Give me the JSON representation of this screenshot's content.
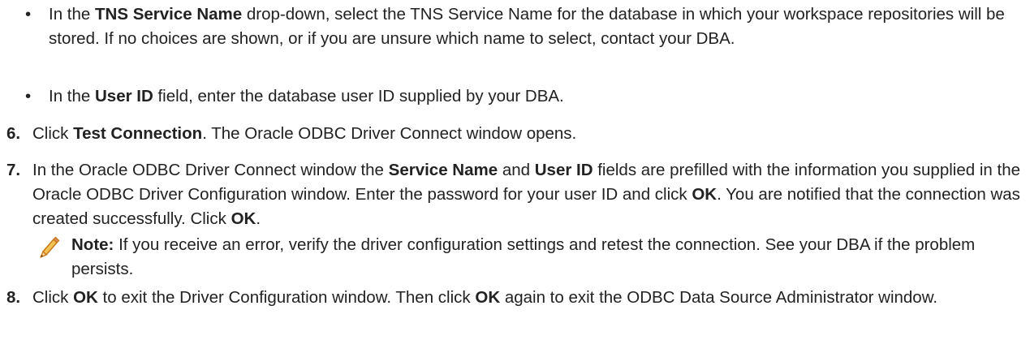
{
  "bullets": [
    {
      "pre": "In the ",
      "strong": "TNS Service Name",
      "post": " drop-down, select the TNS Service Name for the database in which your workspace repositories will be stored. If no choices are shown, or if you are unsure which name to select, contact your DBA."
    },
    {
      "pre": "In the ",
      "strong": "User ID",
      "post": " field, enter the database user ID supplied by your DBA."
    }
  ],
  "steps": {
    "s6": {
      "num": "6.",
      "t1": "Click ",
      "b1": "Test Connection",
      "t2": ". The Oracle ODBC Driver Connect window opens."
    },
    "s7": {
      "num": "7.",
      "t1": "In the Oracle ODBC Driver Connect window the ",
      "b1": "Service Name",
      "t2": " and ",
      "b2": "User ID",
      "t3": " fields are prefilled with the information you supplied in the Oracle ODBC Driver Configuration window. Enter the password for your user ID and click ",
      "b3": "OK",
      "t4": ". You are notified that the connection was created successfully. Click ",
      "b4": "OK",
      "t5": "."
    },
    "s8": {
      "num": "8.",
      "t1": "Click ",
      "b1": "OK",
      "t2": " to exit the Driver Configuration window. Then click ",
      "b2": "OK",
      "t3": " again to exit the ODBC Data Source Administrator window."
    }
  },
  "note": {
    "icon": "pencil-icon",
    "label": "Note:",
    "text": " If you receive an error, verify the driver configuration settings and retest the connection. See your DBA if the problem persists."
  }
}
